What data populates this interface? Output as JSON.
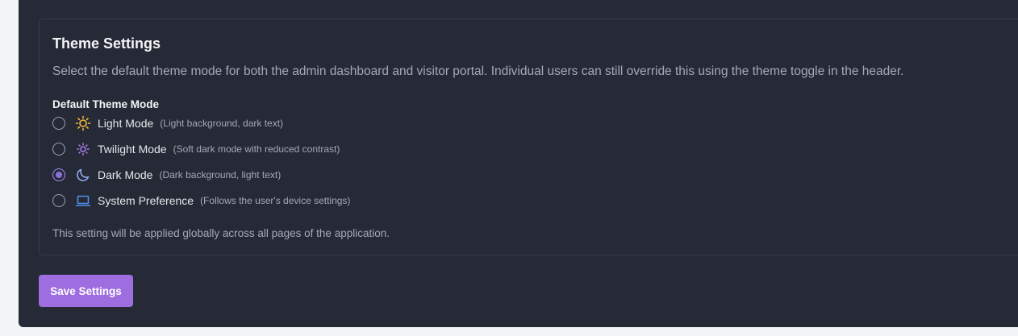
{
  "theme_settings": {
    "title": "Theme Settings",
    "description": "Select the default theme mode for both the admin dashboard and visitor portal. Individual users can still override this using the theme toggle in the header.",
    "field_label": "Default Theme Mode",
    "options": [
      {
        "label": "Light Mode",
        "hint": "(Light background, dark text)",
        "icon": "sun-icon",
        "icon_color": "#f5b93a",
        "checked": false
      },
      {
        "label": "Twilight Mode",
        "hint": "(Soft dark mode with reduced contrast)",
        "icon": "sun-small-icon",
        "icon_color": "#b07ef0",
        "checked": false
      },
      {
        "label": "Dark Mode",
        "hint": "(Dark background, light text)",
        "icon": "moon-icon",
        "icon_color": "#8fa6f0",
        "checked": true
      },
      {
        "label": "System Preference",
        "hint": "(Follows the user's device settings)",
        "icon": "laptop-icon",
        "icon_color": "#4f8ff0",
        "checked": false
      }
    ],
    "footnote": "This setting will be applied globally across all pages of the application."
  },
  "save_button": {
    "label": "Save Settings",
    "color": "#9e6ee0"
  },
  "colors": {
    "page_bg": "#f3f4f6",
    "card_bg": "#262a36",
    "accent": "#8b6fd9"
  }
}
